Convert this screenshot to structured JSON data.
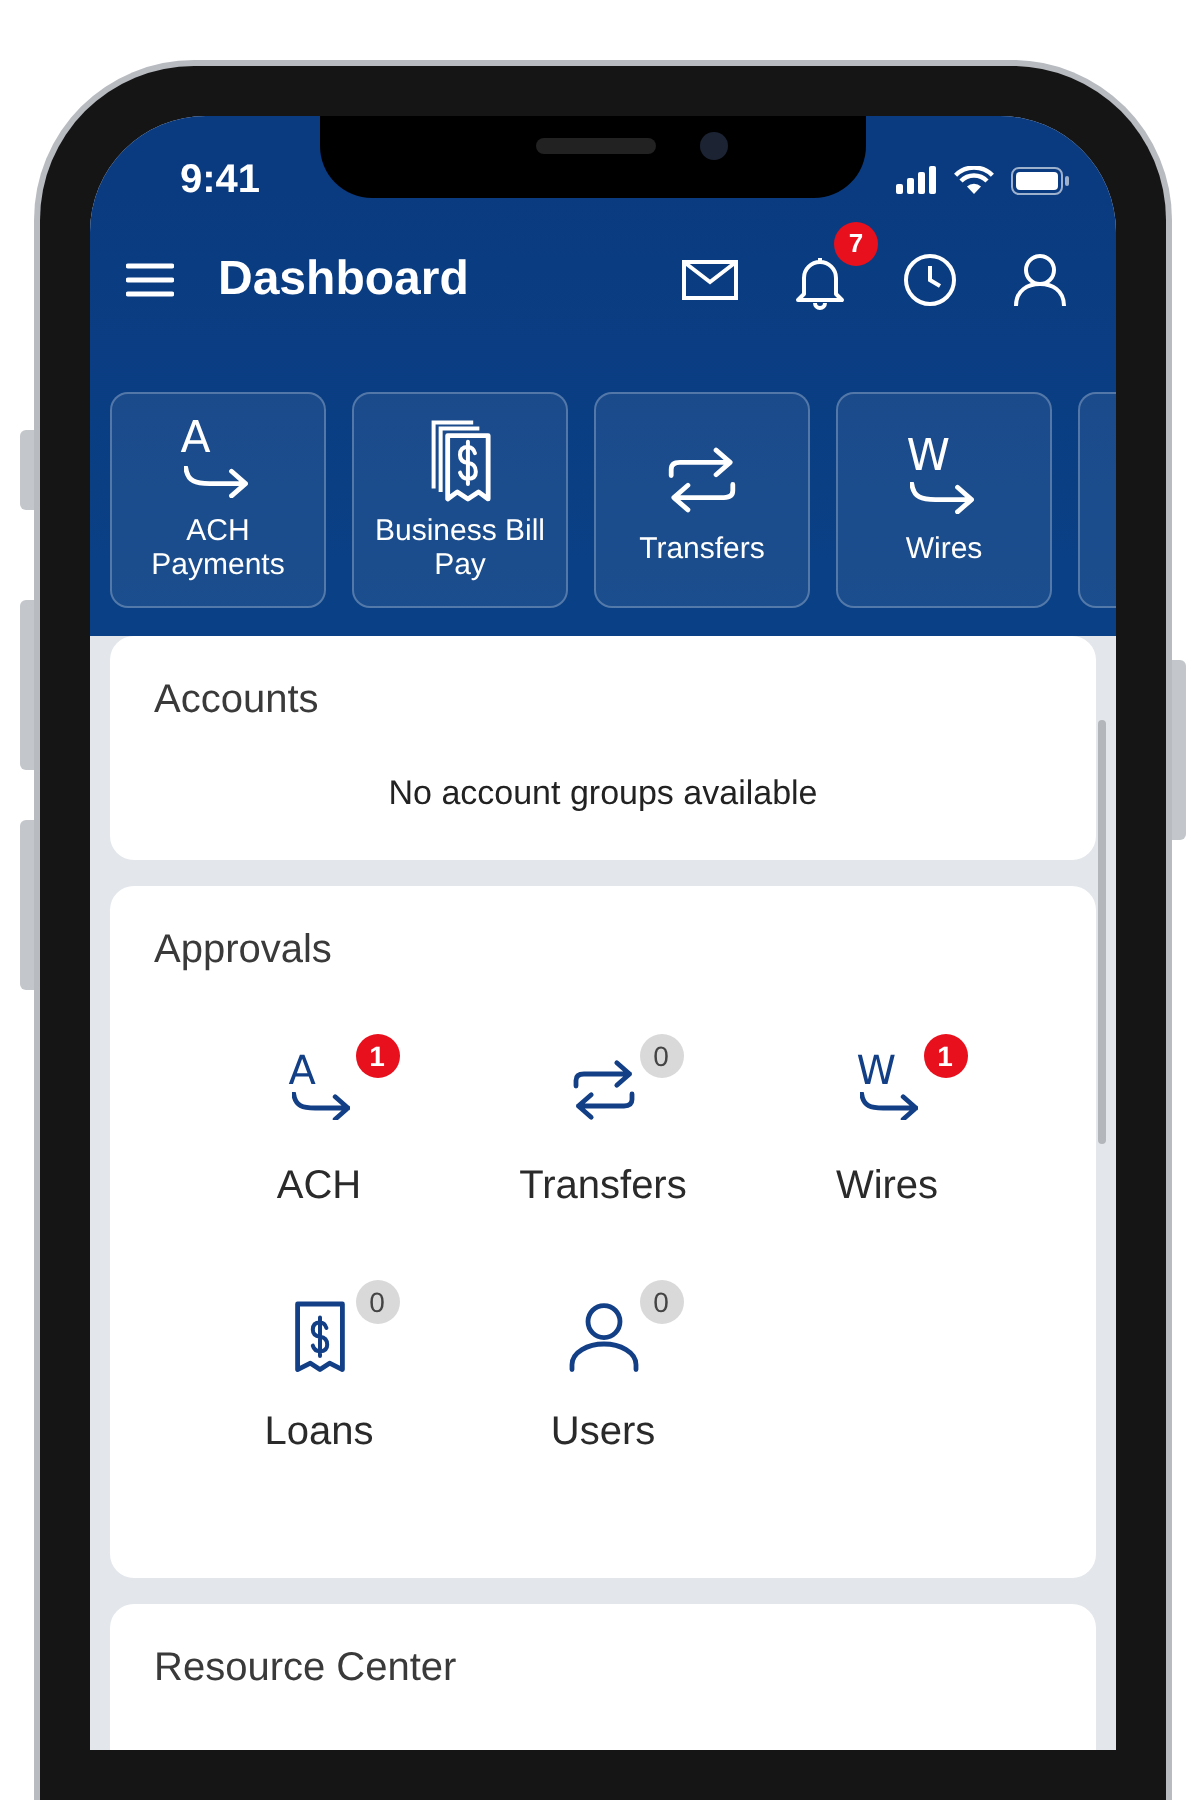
{
  "status_bar": {
    "time": "9:41"
  },
  "header": {
    "title": "Dashboard",
    "notification_count": "7"
  },
  "quick_actions": [
    {
      "kind": "letter-arrow",
      "glyph": "A",
      "label": "ACH Payments"
    },
    {
      "kind": "bill",
      "label": "Business Bill Pay"
    },
    {
      "kind": "transfer",
      "label": "Transfers"
    },
    {
      "kind": "letter-arrow",
      "glyph": "W",
      "label": "Wires"
    }
  ],
  "accounts": {
    "title": "Accounts",
    "message": "No account groups available"
  },
  "approvals": {
    "title": "Approvals",
    "items": [
      {
        "kind": "letter-arrow",
        "glyph": "A",
        "label": "ACH",
        "count": "1",
        "color": "#e8101c"
      },
      {
        "kind": "transfer",
        "label": "Transfers",
        "count": "0",
        "color": "#d9d9d9"
      },
      {
        "kind": "letter-arrow",
        "glyph": "W",
        "label": "Wires",
        "count": "1",
        "color": "#e8101c"
      },
      {
        "kind": "receipt",
        "label": "Loans",
        "count": "0",
        "color": "#d9d9d9"
      },
      {
        "kind": "user",
        "label": "Users",
        "count": "0",
        "color": "#d9d9d9"
      }
    ]
  },
  "resource_center": {
    "title": "Resource Center"
  }
}
